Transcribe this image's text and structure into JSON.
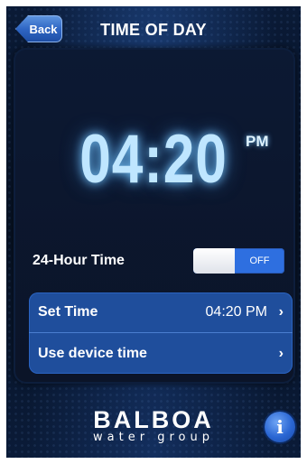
{
  "header": {
    "back_label": "Back",
    "title": "TIME OF DAY"
  },
  "clock": {
    "time": "04:20",
    "meridiem": "PM"
  },
  "hour_format": {
    "label": "24-Hour Time",
    "toggle_state": "OFF"
  },
  "settings_list": [
    {
      "label": "Set Time",
      "value": "04:20 PM",
      "chevron": "›"
    },
    {
      "label": "Use device time",
      "value": "",
      "chevron": "›"
    }
  ],
  "footer": {
    "logo_brand": "BALBOA",
    "logo_sub": "water group",
    "info_icon": "i"
  },
  "colors": {
    "accent": "#2e6fe0",
    "background": "#0a1a36",
    "clock_glow": "#bfe6ff"
  }
}
